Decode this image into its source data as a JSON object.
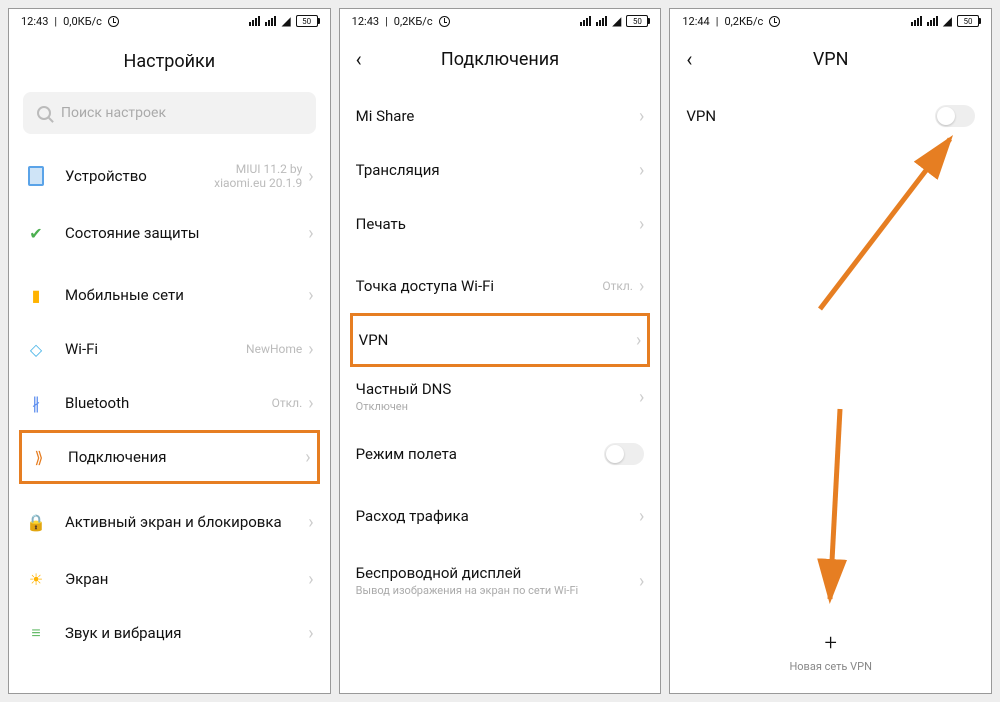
{
  "screens": {
    "s1": {
      "status": {
        "time": "12:43",
        "speed": "0,0КБ/с",
        "battery": "50"
      },
      "title": "Настройки",
      "search_placeholder": "Поиск настроек",
      "items": [
        {
          "label": "Устройство",
          "value": "MIUI 11.2 by xiaomi.eu 20.1.9"
        },
        {
          "label": "Состояние защиты"
        },
        {
          "label": "Мобильные сети"
        },
        {
          "label": "Wi-Fi",
          "value": "NewHome"
        },
        {
          "label": "Bluetooth",
          "value": "Откл."
        },
        {
          "label": "Подключения"
        },
        {
          "label": "Активный экран и блокировка"
        },
        {
          "label": "Экран"
        },
        {
          "label": "Звук и вибрация"
        }
      ]
    },
    "s2": {
      "status": {
        "time": "12:43",
        "speed": "0,2КБ/с",
        "battery": "50"
      },
      "title": "Подключения",
      "items": [
        {
          "label": "Mi Share"
        },
        {
          "label": "Трансляция"
        },
        {
          "label": "Печать"
        },
        {
          "label": "Точка доступа Wi-Fi",
          "value": "Откл."
        },
        {
          "label": "VPN"
        },
        {
          "label": "Частный DNS",
          "sub": "Отключен"
        },
        {
          "label": "Режим полета"
        },
        {
          "label": "Расход трафика"
        },
        {
          "label": "Беспроводной дисплей",
          "sub": "Вывод изображения на экран по сети Wi-Fi"
        }
      ]
    },
    "s3": {
      "status": {
        "time": "12:44",
        "speed": "0,2КБ/с",
        "battery": "50"
      },
      "title": "VPN",
      "vpn_label": "VPN",
      "add_label": "Новая сеть VPN"
    }
  }
}
